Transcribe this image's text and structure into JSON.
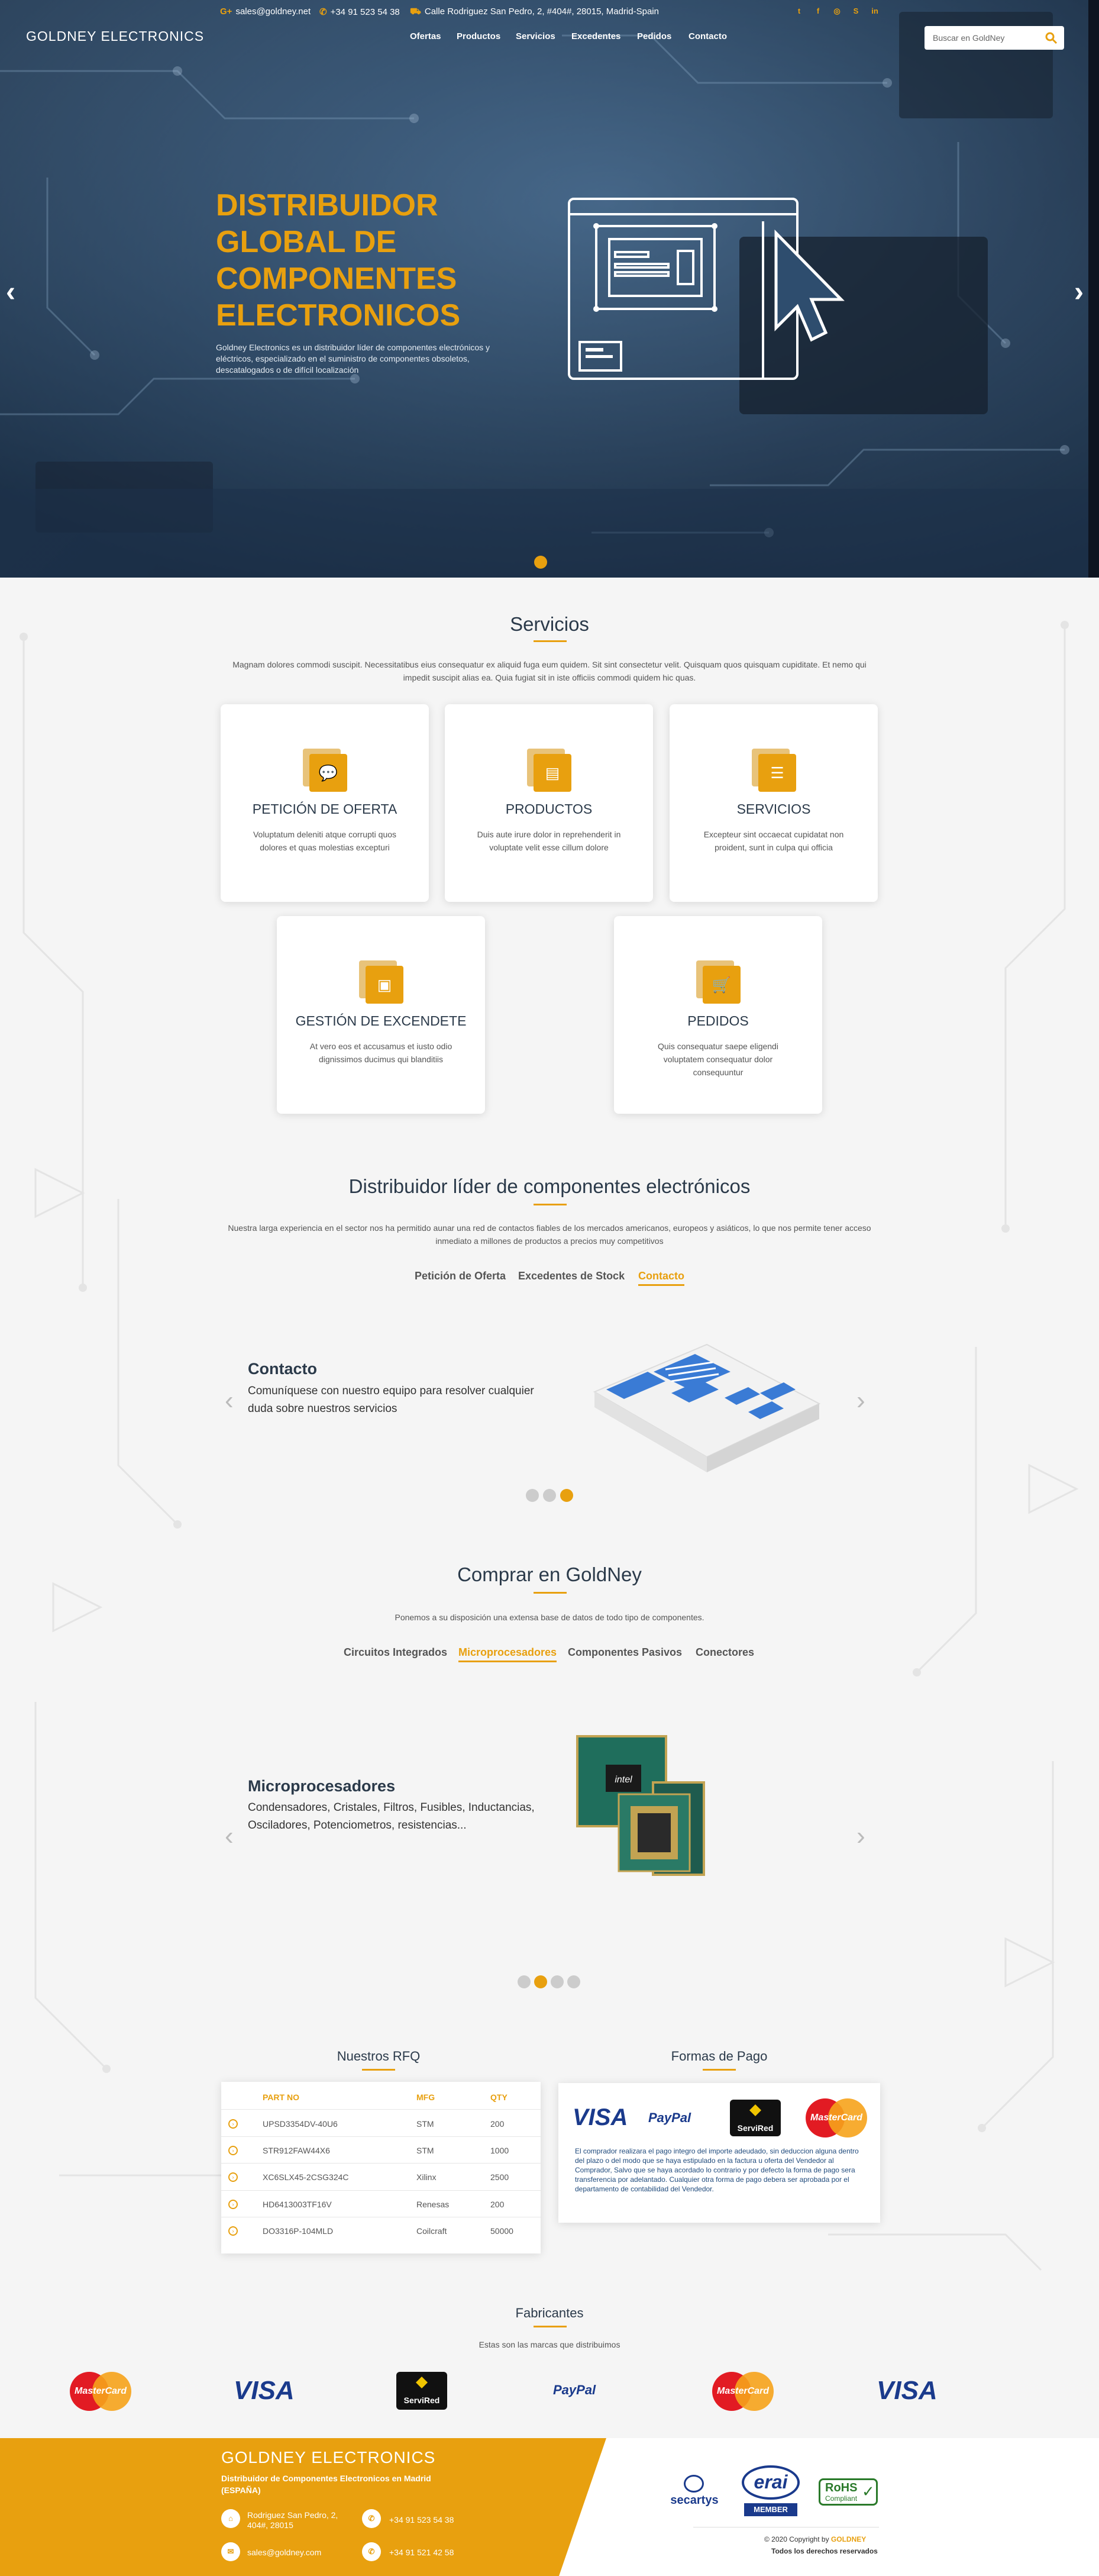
{
  "colors": {
    "accent": "#e8a00f",
    "navy": "#2b3a4a",
    "hero_bg": "#2e4d6e"
  },
  "topbar": {
    "email": "sales@goldney.net",
    "phone": "+34 91 523 54 38",
    "address": "Calle Rodriguez San Pedro, 2, #404#, 28015, Madrid-Spain",
    "email_icon": "google-plus-icon",
    "phone_icon": "phone-icon",
    "address_icon": "map-icon",
    "social": [
      "twitter-icon",
      "facebook-icon",
      "instagram-icon",
      "skype-icon",
      "linkedin-icon"
    ]
  },
  "header": {
    "logo": "GOLDNEY ELECTRONICS",
    "nav": [
      "Ofertas",
      "Productos",
      "Servicios",
      "Excedentes",
      "Pedidos",
      "Contacto"
    ],
    "search_placeholder": "Buscar en GoldNey"
  },
  "hero": {
    "title_lines": [
      "DISTRIBUIDOR",
      "GLOBAL DE",
      "COMPONENTES",
      "ELECTRONICOS"
    ],
    "text": "Goldney Electronics es un distribuidor líder de componentes electrónicos y eléctricos, especializado en el suministro de componentes obsoletos, descatalogados o de difícil localización",
    "prev": "‹",
    "next": "›"
  },
  "servicios": {
    "title": "Servicios",
    "text": "Magnam dolores commodi suscipit. Necessitatibus eius consequatur ex aliquid fuga eum quidem. Sit sint consectetur velit. Quisquam quos quisquam cupiditate. Et nemo qui impedit suscipit alias ea. Quia fugiat sit in iste officiis commodi quidem hic quas.",
    "cards": [
      {
        "title": "PETICIÓN DE OFERTA",
        "text": "Voluptatum deleniti atque corrupti quos dolores et quas molestias excepturi",
        "icon": "chat-icon"
      },
      {
        "title": "PRODUCTOS",
        "text": "Duis aute irure dolor in reprehenderit in voluptate velit esse cillum dolore",
        "icon": "clipboard-icon"
      },
      {
        "title": "SERVICIOS",
        "text": "Excepteur sint occaecat cupidatat non proident, sunt in culpa qui officia",
        "icon": "server-icon"
      },
      {
        "title": "GESTIÓN DE EXCENDETE",
        "text": "At vero eos et accusamus et iusto odio dignissimos ducimus qui blanditiis",
        "icon": "lock-icon"
      },
      {
        "title": "PEDIDOS",
        "text": "Quis consequatur saepe eligendi voluptatem consequatur dolor consequuntur",
        "icon": "cart-icon"
      }
    ]
  },
  "distribuidor": {
    "title": "Distribuidor líder de componentes electrónicos",
    "text": "Nuestra larga experiencia en el sector nos ha permitido aunar una red de contactos fiables de los mercados americanos, europeos y asiáticos, lo que nos permite tener acceso inmediato a millones de productos a precios muy competitivos",
    "tabs": [
      "Petición de Oferta",
      "Excedentes de Stock",
      "Contacto"
    ],
    "active_tab": 2,
    "slide_title": "Contacto",
    "slide_text": "Comuníquese con nuestro equipo para resolver cualquier duda sobre nuestros servicios",
    "dots_active": 3,
    "dots_total": 3
  },
  "comprar": {
    "title": "Comprar en GoldNey",
    "text": "Ponemos a su disposición una extensa base de datos de todo tipo de componentes.",
    "tabs": [
      "Circuitos Integrados",
      "Microprocesadores",
      "Componentes Pasivos",
      "Conectores"
    ],
    "active_tab": 1,
    "slide_title": "Microprocesadores",
    "slide_text": "Condensadores, Cristales, Filtros, Fusibles, Inductancias, Osciladores, Potenciometros, resistencias...",
    "dots_active": 2,
    "dots_total": 4
  },
  "rfq": {
    "title": "Nuestros RFQ",
    "headers": [
      "PART NO",
      "MFG",
      "QTY"
    ],
    "rows": [
      [
        "UPSD3354DV-40U6",
        "STM",
        "200"
      ],
      [
        "STR912FAW44X6",
        "STM",
        "1000"
      ],
      [
        "XC6SLX45-2CSG324C",
        "Xilinx",
        "2500"
      ],
      [
        "HD6413003TF16V",
        "Renesas",
        "200"
      ],
      [
        "DO3316P-104MLD",
        "Coilcraft",
        "50000"
      ]
    ]
  },
  "pagos": {
    "title": "Formas de Pago",
    "logos": [
      "VISA",
      "PayPal",
      "ServiRed",
      "MasterCard"
    ],
    "text": "El comprador realizara el pago integro del importe adeudado, sin deduccion alguna dentro del plazo o del modo que se haya estipulado en la factura u oferta del Vendedor al Comprador, Salvo que se haya acordado lo contrario y por defecto la forma de pago sera transferencia por adelantado. Cualquier otra forma de pago debera ser aprobada por el departamento de contabilidad del Vendedor."
  },
  "fabricantes": {
    "title": "Fabricantes",
    "text": "Estas son las marcas que distribuimos",
    "logos": [
      "MasterCard",
      "VISA",
      "ServiRed",
      "PayPal",
      "MasterCard",
      "VISA"
    ]
  },
  "footer": {
    "title": "GOLDNEY ELECTRONICS",
    "subtitle": "Distribuidor de Componentes Electronicos en Madrid (ESPAÑA)",
    "address": "Rodriguez San Pedro, 2, 404#, 28015",
    "email": "sales@goldney.com",
    "phone1": "+34 91 523 54 38",
    "phone2": "+34 91 521 42 58",
    "copyright": "© 2020 Copyright by",
    "copyright_brand": "GOLDNEY",
    "rights": "Todos los derechos reservados",
    "certs": [
      "secartys",
      "erai",
      "MEMBER",
      "RoHS",
      "Compliant"
    ]
  }
}
